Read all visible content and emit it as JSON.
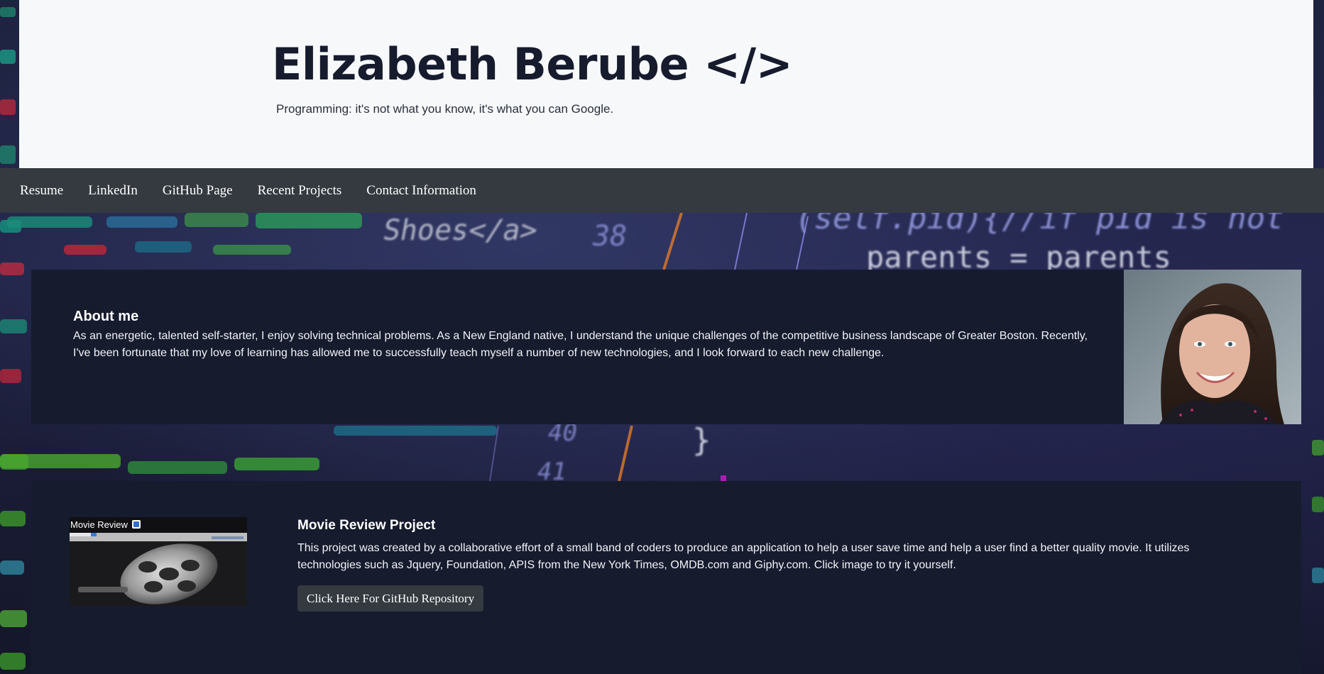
{
  "header": {
    "title": "Elizabeth Berube </>",
    "tagline": "Programming: it's not what you know, it's what you can Google."
  },
  "nav": {
    "items": [
      {
        "label": "Resume"
      },
      {
        "label": "LinkedIn"
      },
      {
        "label": "GitHub Page"
      },
      {
        "label": "Recent Projects"
      },
      {
        "label": "Contact Information"
      }
    ]
  },
  "background": {
    "code_fragments": [
      "Shoes</a>",
      "38",
      "(self.pid){//if pId is not",
      "parents = parents",
      "40",
      "}",
      "41"
    ]
  },
  "about": {
    "title": "About me",
    "text": "As an energetic, talented self-starter, I enjoy solving technical problems. As a New England native, I understand the unique challenges of the competitive business landscape of Greater Boston. Recently, I've been fortunate that my love of learning has allowed me to successfully teach myself a number of new technologies, and I look forward to each new challenge."
  },
  "project": {
    "thumbnail_title": "Movie Review",
    "title": "Movie Review Project",
    "text": "This project was created by a collaborative effort of a small band of coders to produce an application to help a user save time and help a user find a better quality movie. It utilizes technologies such as Jquery, Foundation, APIS from the New York Times, OMDB.com and Giphy.com. Click image to try it yourself.",
    "button_label": "Click Here For GitHub Repository"
  },
  "colors": {
    "header_bg": "#f7f8fa",
    "navbar_bg": "#343a40",
    "card_bg": "#161b2e",
    "title_text": "#161c2d",
    "button_bg": "#343a40"
  }
}
